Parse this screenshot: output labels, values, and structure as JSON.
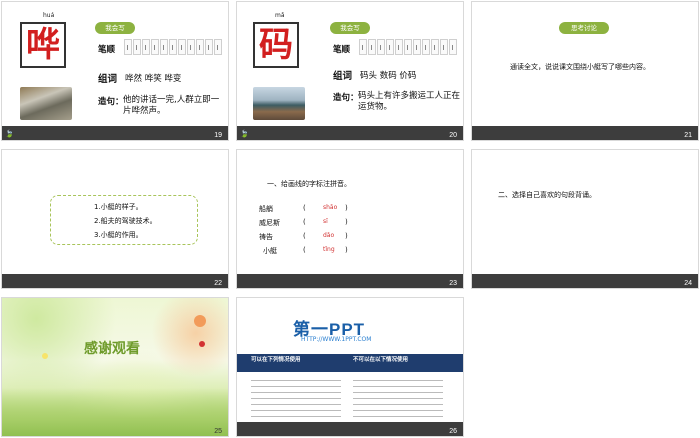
{
  "icons": {
    "leaf": "🍃"
  },
  "slides": {
    "s19": {
      "number": "19",
      "pinyin": "huá",
      "character": "哗",
      "pill": "我会写",
      "bishun_label": "笔顺",
      "zuci_label": "组词",
      "words": "哗然  哗笑  哗变",
      "zaoju_label": "造句：",
      "sentence": "他的讲话一完,人群立即一片哗然声。"
    },
    "s20": {
      "number": "20",
      "pinyin": "mǎ",
      "character": "码",
      "pill": "我会写",
      "bishun_label": "笔顺",
      "zuci_label": "组词",
      "words": "码头  数码  价码",
      "zaoju_label": "造句：",
      "sentence": "码头上有许多搬运工人正在运货物。"
    },
    "s21": {
      "number": "21",
      "pill": "思考讨论",
      "prompt": "通读全文，说说课文围绕小艇写了哪些内容。"
    },
    "s22": {
      "number": "22",
      "items": [
        "1.小艇的样子。",
        "2.船夫的驾驶技术。",
        "3.小艇的作用。"
      ]
    },
    "s23": {
      "number": "23",
      "heading": "一、给画线的字标注拼音。",
      "paren_open": "(",
      "paren_close": ")",
      "rows": [
        {
          "word": "船艄",
          "pinyin": "shāo"
        },
        {
          "word": "威尼斯",
          "pinyin": "sī"
        },
        {
          "word": "祷告",
          "pinyin": "dǎo"
        },
        {
          "word": "小艇",
          "pinyin": "tǐng"
        }
      ]
    },
    "s24": {
      "number": "24",
      "heading": "二、选择自己喜欢的句段背诵。"
    },
    "s25": {
      "number": "25",
      "title": "感谢观看"
    },
    "s26": {
      "number": "26",
      "logo": "第一PPT",
      "url": "HTTP://WWW.1PPT.COM",
      "allowed_heading": "可以在下列情况使用",
      "forbidden_heading": "不可以在以下情况使用"
    }
  }
}
